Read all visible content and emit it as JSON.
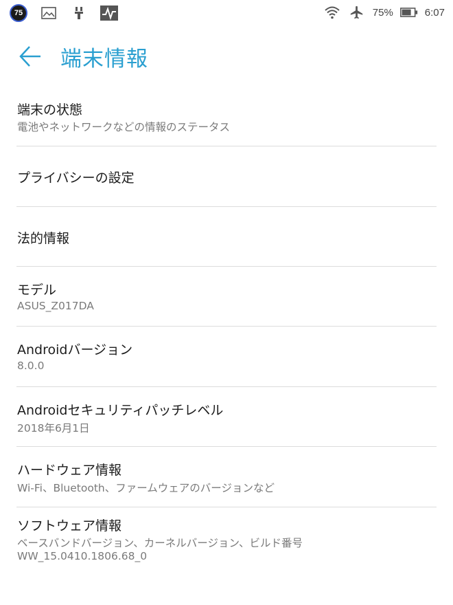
{
  "status_bar": {
    "badge": "75",
    "battery_percent": "75%",
    "time": "6:07",
    "icons": [
      "image-icon",
      "usb-debug-icon",
      "activity-icon",
      "wifi-icon",
      "airplane-icon",
      "battery-icon"
    ]
  },
  "app_bar": {
    "title": "端末情報",
    "accent_color": "#2a9fd0"
  },
  "items": [
    {
      "title": "端末の状態",
      "subtitle": "電池やネットワークなどの情報のステータス"
    },
    {
      "title": "プライバシーの設定"
    },
    {
      "title": "法的情報"
    },
    {
      "title": "モデル",
      "subtitle": "ASUS_Z017DA"
    },
    {
      "title": "Androidバージョン",
      "subtitle": "8.0.0"
    },
    {
      "title": "Androidセキュリティパッチレベル",
      "subtitle": "2018年6月1日"
    },
    {
      "title": "ハードウェア情報",
      "subtitle": "Wi-Fi、Bluetooth、ファームウェアのバージョンなど"
    },
    {
      "title": "ソフトウェア情報",
      "subtitle": "ベースバンドバージョン、カーネルバージョン、ビルド番号",
      "subtitle2": "WW_15.0410.1806.68_0"
    }
  ]
}
